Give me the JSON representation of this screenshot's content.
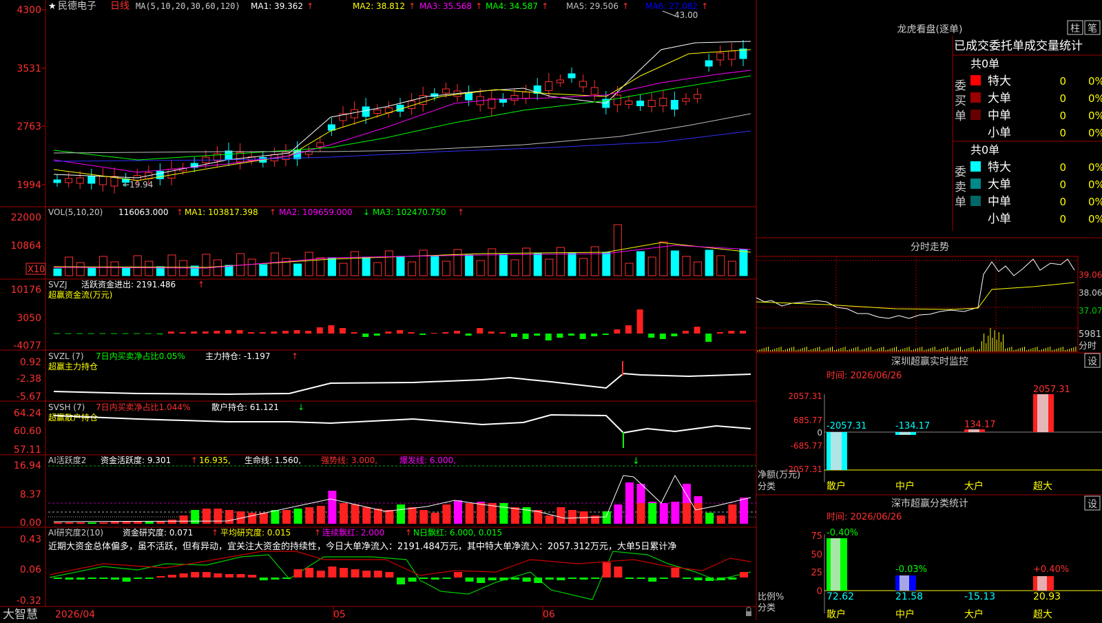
{
  "header": {
    "star": "★",
    "name": "民德电子",
    "period": "日线",
    "ma_label": "MA(5,10,20,30,60,120)",
    "mas": [
      {
        "text": "MA1: 39.362",
        "color": "#ffffff"
      },
      {
        "text": "MA2: 38.812",
        "color": "#ffff00"
      },
      {
        "text": "MA3: 35.568",
        "color": "#ff00ff"
      },
      {
        "text": "MA4: 34.587",
        "color": "#00ff00"
      },
      {
        "text": "MA5: 29.506",
        "color": "#c0c0c0"
      },
      {
        "text": "MA6: 27.082",
        "color": "#0000ff"
      }
    ],
    "up_arrow": "↑",
    "down_arrow": "↓"
  },
  "price_axis": [
    "4300",
    "3531",
    "2763",
    "1994"
  ],
  "price_annot": {
    "high": "43.00",
    "low": "←19.94"
  },
  "vol": {
    "label": "VOL(5,10,20)",
    "value": "116063.000",
    "ma1": "MA1: 103817.398",
    "ma2": "MA2: 109659.000",
    "ma3": "MA3: 102470.750",
    "axis": [
      "22000",
      "10864"
    ],
    "unit": "X10"
  },
  "svzj": {
    "label": "SVZJ",
    "desc": "活跃资金进出: 2191.486",
    "sub": "超赢资金流(万元)",
    "axis": [
      "10176",
      "3050",
      "-4077"
    ]
  },
  "svzl": {
    "label": "SVZL (7)",
    "desc1": "7日内买卖净占比0.05%",
    "desc2": "主力持仓: -1.197",
    "sub": "超赢主力持仓",
    "axis": [
      "0.92",
      "-2.38",
      "-5.67"
    ]
  },
  "svsh": {
    "label": "SVSH (7)",
    "desc1": "7日内买卖净占比1.044%",
    "desc2": "散户持仓: 61.121",
    "sub": "超赢散户持仓",
    "axis": [
      "64.24",
      "60.60",
      "57.11"
    ]
  },
  "ai2": {
    "label": "AI活跃度2",
    "d1": "资金活跃度: 9.301",
    "d2": "16.935,",
    "d3": "生命线: 1.560,",
    "d4": "强势线: 3.000,",
    "d5": "爆发线: 6.000,",
    "axis": [
      "16.94",
      "8.37",
      "0.00"
    ]
  },
  "ai_res": {
    "label": "AI研究度2(10)",
    "d1": "资金研究度: 0.071",
    "d2": "平均研究度: 0.015",
    "d3": "连续飘红: 2.000",
    "d4": "N日飘红: 6.000, 0.015",
    "axis": [
      "0.43",
      "0.06",
      "-0.32"
    ],
    "comment": "近期大资金总体偏多，虽不活跃，但有异动，宜关注大资金的持续性，今日大单净流入：2191.484万元，其中特大单净流入：2057.312万元，大单5日累计净"
  },
  "bottom": {
    "brand": "大智慧",
    "date_start": "2026/04",
    "m05": "05",
    "m06": "06"
  },
  "lhkp": {
    "title": "龙虎看盘(逐单)",
    "btn_bar": "柱",
    "btn_bi": "笔",
    "stats_title": "已成交委托单成交量统计",
    "buy_label": "委买单",
    "sell_label": "委卖单",
    "buy_total": "共0单",
    "sell_total": "共0单",
    "buy_rows": [
      {
        "name": "特大",
        "val": "0",
        "pct": "0%",
        "color": "#ff0000"
      },
      {
        "name": "大单",
        "val": "0",
        "pct": "0%",
        "color": "#990000"
      },
      {
        "name": "中单",
        "val": "0",
        "pct": "0%",
        "color": "#660000"
      },
      {
        "name": "小单",
        "val": "0",
        "pct": "0%",
        "color": ""
      }
    ],
    "sell_rows": [
      {
        "name": "特大",
        "val": "0",
        "pct": "0%",
        "color": "#00ffff"
      },
      {
        "name": "大单",
        "val": "0",
        "pct": "0%",
        "color": "#008888"
      },
      {
        "name": "中单",
        "val": "0",
        "pct": "0%",
        "color": "#006666"
      },
      {
        "name": "小单",
        "val": "0",
        "pct": "0%",
        "color": ""
      }
    ]
  },
  "fenshi": {
    "title": "分时走势",
    "p1": "39.06",
    "p2": "38.06",
    "p3": "37.07",
    "vol": "5981",
    "unit": "分时"
  },
  "sz_monitor": {
    "title": "深圳超赢实时监控",
    "btn": "设",
    "time": "时间: 2026/06/26",
    "axis": [
      "2057.31",
      "685.77",
      "0",
      "-685.77",
      "-2057.31"
    ],
    "vlabels": [
      "-2057.31",
      "-134.17",
      "134.17",
      "2057.31"
    ],
    "cats": [
      "散户",
      "中户",
      "大户",
      "超大"
    ],
    "ylabel": "净额(万元)",
    "xlabel": "分类"
  },
  "sz_class": {
    "title": "深市超赢分类统计",
    "btn": "设",
    "time": "时间: 2026/06/26",
    "axis": [
      "75",
      "50",
      "25",
      "0"
    ],
    "top_labels": [
      "-0.40%",
      "-0.03%",
      "+0.40%"
    ],
    "vals": [
      "72.62",
      "21.58",
      "-15.13",
      "20.93"
    ],
    "cats": [
      "散户",
      "中户",
      "大户",
      "超大"
    ],
    "ylabel": "比例%",
    "xlabel": "分类"
  }
}
